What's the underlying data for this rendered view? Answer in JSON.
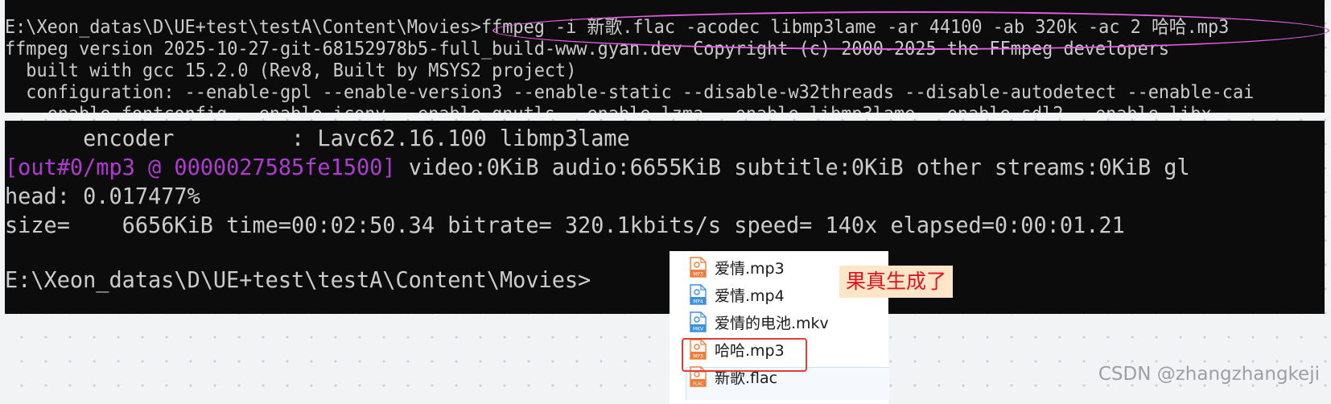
{
  "terminal_top": {
    "lines": [
      "E:\\Xeon_datas\\D\\UE+test\\testA\\Content\\Movies>ffmpeg -i 新歌.flac -acodec libmp3lame -ar 44100 -ab 320k -ac 2 哈哈.mp3",
      "ffmpeg version 2025-10-27-git-68152978b5-full_build-www.gyan.dev Copyright (c) 2000-2025 the FFmpeg developers",
      "  built with gcc 15.2.0 (Rev8, Built by MSYS2 project)",
      "  configuration: --enable-gpl --enable-version3 --enable-static --disable-w32threads --disable-autodetect --enable-cai"
    ]
  },
  "terminal_bottom": {
    "encoder_line": "      encoder         : Lavc62.16.100 libmp3lame",
    "out_tag": "[out#0/mp3 @ 0000027585fe1500]",
    "out_rest": " video:0KiB audio:6655KiB subtitle:0KiB other streams:0KiB gl",
    "head_line": "head: 0.017477%",
    "size_line": "size=    6656KiB time=00:02:50.34 bitrate= 320.1kbits/s speed= 140x elapsed=0:00:01.21",
    "prompt_line": "E:\\Xeon_datas\\D\\UE+test\\testA\\Content\\Movies>"
  },
  "files": [
    {
      "name": "爱情.mp3",
      "icon": "mp3-file-icon",
      "tag": "MP3",
      "color": "#ef7d3c"
    },
    {
      "name": "爱情.mp4",
      "icon": "mp4-file-icon",
      "tag": "MP4",
      "color": "#3d8fe0"
    },
    {
      "name": "爱情的电池.mkv",
      "icon": "mkv-file-icon",
      "tag": "MKV",
      "color": "#3d8fe0"
    },
    {
      "name": "哈哈.mp3",
      "icon": "mp3-file-icon",
      "tag": "MP3",
      "color": "#ef7d3c"
    },
    {
      "name": "新歌.flac",
      "icon": "flac-file-icon",
      "tag": "FLAC",
      "color": "#ef7d3c"
    }
  ],
  "annotation": "果真生成了",
  "watermark": "CSDN @zhangzhangkeji",
  "colors": {
    "highlight_box": "#e23c36",
    "ellipse": "#e75be6",
    "annotation_text": "#e4131f"
  }
}
